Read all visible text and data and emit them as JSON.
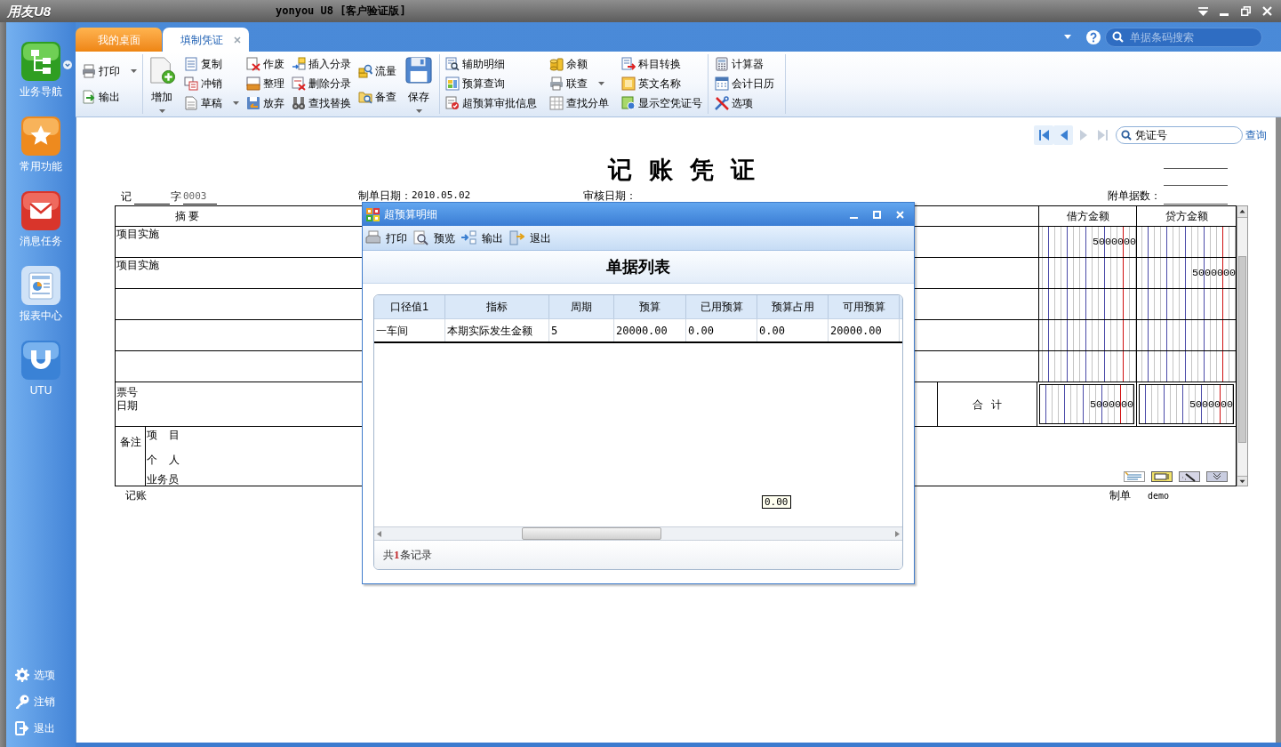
{
  "window": {
    "logo": "用友U8",
    "title": "yonyou U8 [客户验证版]"
  },
  "sidebar": {
    "items": [
      {
        "label": "业务导航",
        "has_menu": true
      },
      {
        "label": "常用功能",
        "has_menu": false
      },
      {
        "label": "消息任务",
        "has_menu": false
      },
      {
        "label": "报表中心",
        "has_menu": false
      },
      {
        "label": "UTU",
        "has_menu": false
      }
    ],
    "footer_items": [
      {
        "label": "选项"
      },
      {
        "label": "注销"
      },
      {
        "label": "退出"
      }
    ]
  },
  "tabs": [
    {
      "label": "我的桌面",
      "selected": false,
      "closable": false
    },
    {
      "label": "填制凭证",
      "selected": true,
      "closable": true
    }
  ],
  "search": {
    "placeholder": "单据条码搜索"
  },
  "toolbar": {
    "groups": [
      {
        "columns": [
          {
            "kind": "small",
            "items": [
              {
                "label": "打印",
                "dropdown": true
              },
              {
                "label": "输出",
                "dropdown": false
              }
            ]
          }
        ]
      },
      {
        "columns": [
          {
            "kind": "large",
            "items": [
              {
                "label": "增加",
                "dropdown": true
              }
            ]
          },
          {
            "kind": "small",
            "items": [
              {
                "label": "复制",
                "dropdown": false
              },
              {
                "label": "冲销",
                "dropdown": false
              },
              {
                "label": "草稿",
                "dropdown": true
              }
            ]
          },
          {
            "kind": "small",
            "items": [
              {
                "label": "作废",
                "dropdown": false
              },
              {
                "label": "整理",
                "dropdown": false
              },
              {
                "label": "放弃",
                "dropdown": false
              }
            ]
          },
          {
            "kind": "small",
            "items": [
              {
                "label": "插入分录",
                "dropdown": false
              },
              {
                "label": "删除分录",
                "dropdown": false
              },
              {
                "label": "查找替换",
                "dropdown": false
              }
            ]
          },
          {
            "kind": "small",
            "items": [
              {
                "label": "流量",
                "dropdown": false
              },
              {
                "label": "备查",
                "dropdown": false
              }
            ]
          },
          {
            "kind": "large",
            "items": [
              {
                "label": "保存",
                "dropdown": true
              }
            ]
          }
        ]
      },
      {
        "columns": [
          {
            "kind": "small",
            "items": [
              {
                "label": "辅助明细",
                "dropdown": false
              },
              {
                "label": "预算查询",
                "dropdown": false
              },
              {
                "label": "超预算审批信息",
                "dropdown": false
              }
            ]
          },
          {
            "kind": "small",
            "items": [
              {
                "label": "余额",
                "dropdown": false
              },
              {
                "label": "联查",
                "dropdown": true
              },
              {
                "label": "查找分单",
                "dropdown": false
              }
            ]
          },
          {
            "kind": "small",
            "items": [
              {
                "label": "科目转换",
                "dropdown": false
              },
              {
                "label": "英文名称",
                "dropdown": false
              },
              {
                "label": "显示空凭证号",
                "dropdown": false
              }
            ]
          }
        ]
      },
      {
        "columns": [
          {
            "kind": "small",
            "items": [
              {
                "label": "计算器",
                "dropdown": false
              },
              {
                "label": "会计日历",
                "dropdown": false
              },
              {
                "label": "选项",
                "dropdown": false
              }
            ]
          }
        ]
      }
    ]
  },
  "voucher": {
    "record_nav": [
      {
        "disabled": false
      },
      {
        "disabled": false
      },
      {
        "disabled": true
      },
      {
        "disabled": true
      }
    ],
    "voucher_search": {
      "placeholder": "凭证号"
    },
    "query_link": "查询",
    "title": "记 账 凭 证",
    "type_word": "记",
    "number_label": "字",
    "number": "0003",
    "created_date": {
      "label": "制单日期：",
      "value": "2010.05.02"
    },
    "review_date": {
      "label": "审核日期："
    },
    "attachments": {
      "label": "附单据数："
    },
    "columns": {
      "summary": "摘 要",
      "debit": "借方金额",
      "credit": "贷方金额"
    },
    "entries": [
      {
        "summary": "项目实施",
        "debit": "5000000"
      },
      {
        "summary": "项目实施",
        "credit": "5000000"
      }
    ],
    "totals": {
      "ticket_label": "票号",
      "date_label": "日期",
      "label": "合 计",
      "debit": "5000000",
      "credit": "5000000"
    },
    "remarks": {
      "label": "备注",
      "fields": [
        "项 目",
        "个 人",
        "业务员"
      ]
    },
    "signatures": [
      {
        "label": "记账"
      },
      {
        "label": "制单",
        "value": "demo"
      }
    ]
  },
  "tooltip": {
    "text": "0.00"
  },
  "dialog": {
    "title": "超预算明细",
    "toolbar": [
      "打印",
      "预览",
      "输出",
      "退出"
    ],
    "heading": "单据列表",
    "columns": [
      "口径值1",
      "指标",
      "周期",
      "预算",
      "已用预算",
      "预算占用",
      "可用预算"
    ],
    "rows": [
      [
        "一车间",
        "本期实际发生金额",
        "5",
        "20000.00",
        "0.00",
        "0.00",
        "20000.00"
      ]
    ],
    "record_count": "共**1**条记录"
  }
}
